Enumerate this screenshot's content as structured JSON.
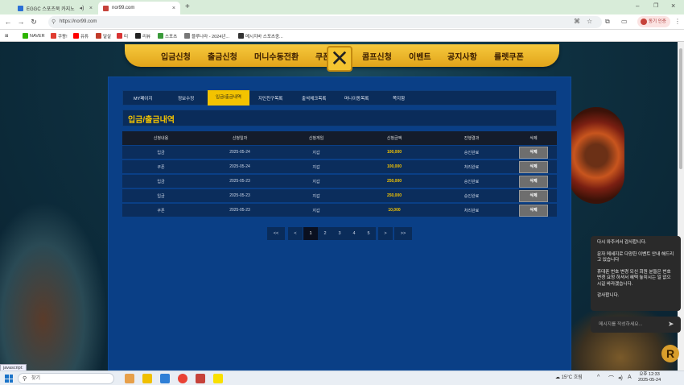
{
  "browser": {
    "tabs": [
      {
        "title": "EGGC 스포츠북 카지노",
        "active": false
      },
      {
        "title": "nor99.com",
        "active": true
      }
    ],
    "url": "https://nor99.com",
    "profile_label": "동기 인증"
  },
  "bookmarks": [
    "NAVER",
    "쿠팡!",
    "유튜",
    "달살",
    "티",
    "리뷰",
    "스포츠",
    "블루나라 - 2024년...",
    "메시지바 스포츠중..."
  ],
  "top_menu": [
    "입금신청",
    "출금신청",
    "머니수동전환",
    "쿠폰",
    "콤프신청",
    "이벤트",
    "공지사항",
    "룰렛쿠폰"
  ],
  "sub_nav": {
    "items": [
      "MY페이지",
      "정보수정",
      "입금/출금내역",
      "지인친구목록",
      "출석체크목록",
      "머니이동목록",
      "쪽지함"
    ],
    "active": "입금/출금내역"
  },
  "page_title": "입금/출금내역",
  "table": {
    "headers": [
      "신청내용",
      "신청일자",
      "신청게임",
      "신청금액",
      "진행결과",
      "삭제"
    ],
    "rows": [
      {
        "type": "입금",
        "date": "2025-05-24",
        "game": "지갑",
        "amount": "100,000",
        "status": "승인완료",
        "action": "삭제"
      },
      {
        "type": "쿠폰",
        "date": "2025-05-24",
        "game": "지갑",
        "amount": "100,000",
        "status": "처리완료",
        "action": "삭제"
      },
      {
        "type": "입금",
        "date": "2025-05-23",
        "game": "지갑",
        "amount": "250,000",
        "status": "승인완료",
        "action": "삭제"
      },
      {
        "type": "입금",
        "date": "2025-05-23",
        "game": "지갑",
        "amount": "250,000",
        "status": "승인완료",
        "action": "삭제"
      },
      {
        "type": "쿠폰",
        "date": "2025-05-23",
        "game": "지갑",
        "amount": "10,000",
        "status": "처리완료",
        "action": "삭제"
      }
    ]
  },
  "pagination": {
    "first": "<<",
    "prev": "<",
    "pages": [
      "1",
      "2",
      "3",
      "4",
      "5"
    ],
    "current": "1",
    "next": ">",
    "last": ">>"
  },
  "chat": {
    "messages": [
      "다시 와주셔서 감사합니다.",
      "문자 메세지로 다양한 이벤트 안내 해드리고 있습니다",
      "휴대폰 번호 변경 되신 회원 분들은 번호 변경 요청 하셔서 혜택 놓치시는 일 없으시길 바라겠습니다.",
      "감사합니다."
    ],
    "input_placeholder": "메시지를 작성하세요..."
  },
  "status_hint": "javascript:",
  "taskbar": {
    "search_label": "찾기",
    "weather": "15°C 흐림",
    "time": "오후 12:33",
    "date": "2025-05-24"
  },
  "colors": {
    "accent": "#f3c300",
    "panel": "#0a3f86",
    "row": "#0b2d5c",
    "menu_gold": "#f6c93d"
  }
}
